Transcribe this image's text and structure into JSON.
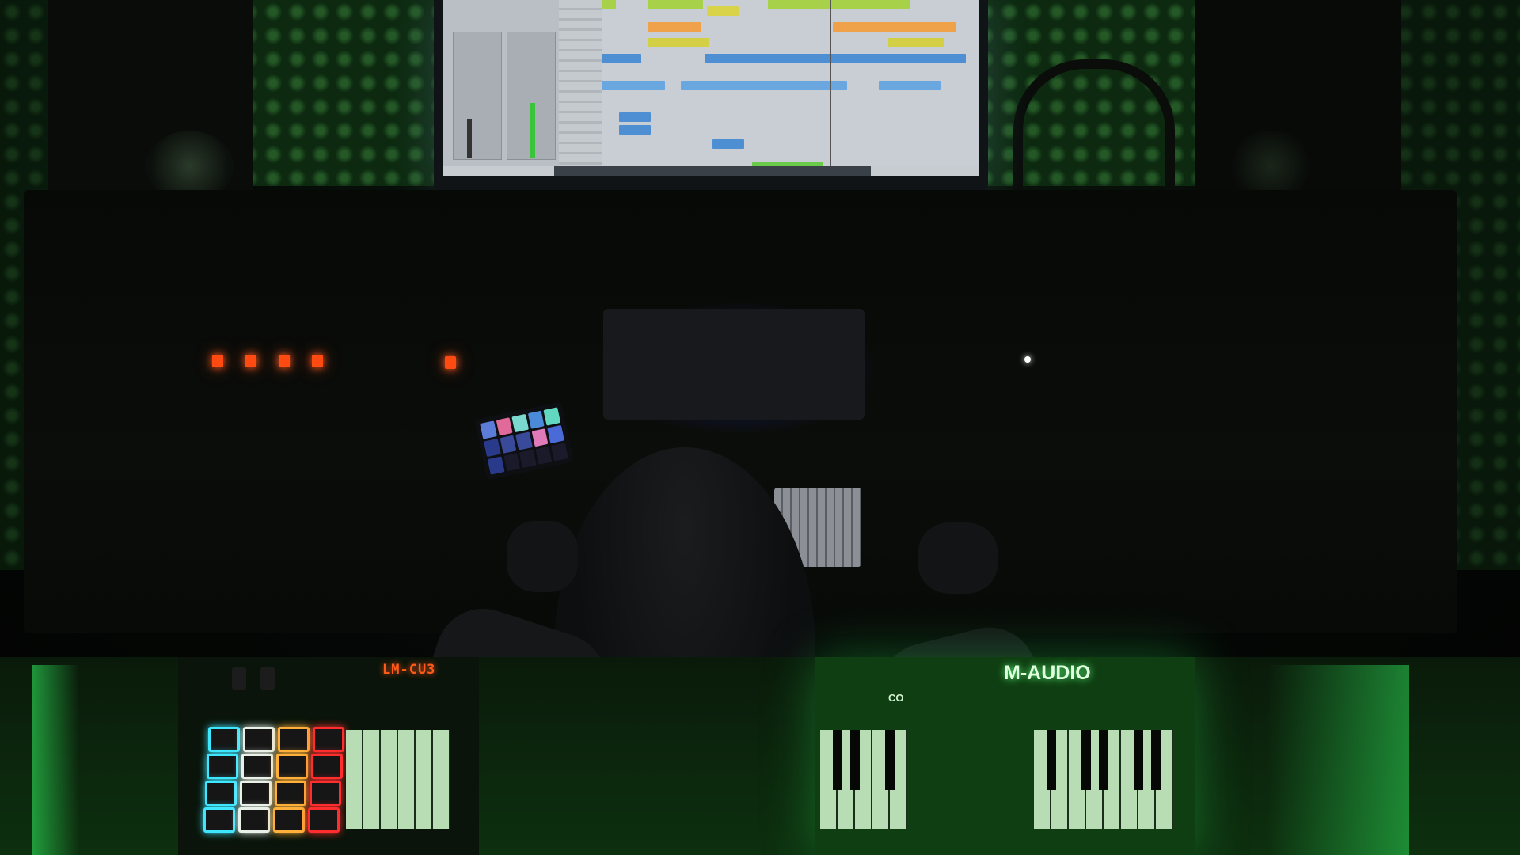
{
  "scene": {
    "description_tags": [
      "music-studio",
      "daw-monitor",
      "midi-keyboard",
      "drum-pads"
    ],
    "colors": {
      "room_glow": "#1f7a28",
      "wall_foam": "#0d2a10",
      "led_red": "#ff4a12",
      "keyboard_glow": "#2ee85a",
      "pad_cyan": "#3ee6ff",
      "pad_white": "#e8f0e8",
      "pad_orange": "#ffb03a",
      "pad_red": "#ff2e2e",
      "desk_blue": "#2a3dff"
    }
  },
  "controller": {
    "display": "LM-CU3"
  },
  "keyboard": {
    "brand": "M-AUDIO",
    "model_fragment": "CO"
  },
  "pads": [
    [
      "cyan",
      "white",
      "orange",
      "red"
    ],
    [
      "cyan",
      "white",
      "orange",
      "red"
    ],
    [
      "cyan",
      "white",
      "orange",
      "red"
    ],
    [
      "cyan",
      "white",
      "orange",
      "red"
    ]
  ],
  "stream_deck": {
    "buttons": 15
  }
}
